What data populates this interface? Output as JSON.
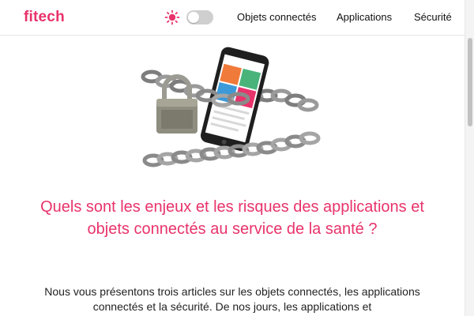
{
  "brand": {
    "name": "fitech",
    "color": "#e8336b"
  },
  "theme_toggle": {
    "icon": "sun-icon",
    "state": "off"
  },
  "nav": {
    "items": [
      {
        "label": "Objets connectés"
      },
      {
        "label": "Applications"
      },
      {
        "label": "Sécurité"
      }
    ]
  },
  "hero": {
    "image": "padlock-chain-phone-illustration"
  },
  "main": {
    "headline": "Quels sont les enjeux et les risques des applications et objets connectés au service de la santé ?",
    "intro": "Nous vous présentons trois articles sur les objets connectés, les applications connectés et la sécurité. De nos jours, les applications et"
  },
  "colors": {
    "accent": "#e8336b",
    "text": "#222222"
  }
}
